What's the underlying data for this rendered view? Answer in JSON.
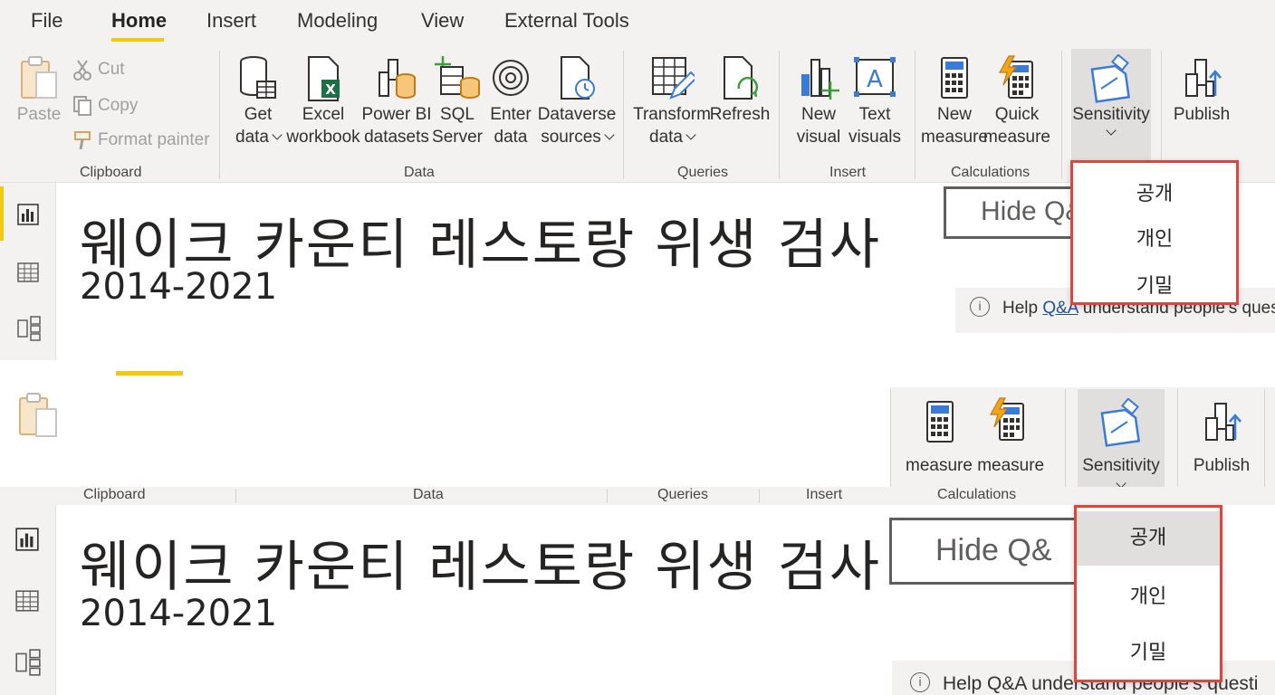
{
  "tabs": [
    "File",
    "Home",
    "Insert",
    "Modeling",
    "View",
    "External Tools"
  ],
  "clipboard": {
    "paste": "Paste",
    "cut": "Cut",
    "copy": "Copy",
    "format_painter": "Format painter",
    "group": "Clipboard"
  },
  "data_group": {
    "get_data": [
      "Get",
      "data"
    ],
    "excel": [
      "Excel",
      "workbook"
    ],
    "powerbi": [
      "Power BI",
      "datasets"
    ],
    "sql": [
      "SQL",
      "Server"
    ],
    "enter": [
      "Enter",
      "data"
    ],
    "dataverse": [
      "Dataverse",
      "sources"
    ],
    "group": "Data"
  },
  "queries": {
    "transform": [
      "Transform",
      "data"
    ],
    "refresh": "Refresh",
    "group": "Queries"
  },
  "insert": {
    "new_visual": [
      "New",
      "visual"
    ],
    "text_visuals": [
      "Text",
      "visuals"
    ],
    "group": "Insert"
  },
  "calculations": {
    "new_measure": [
      "New",
      "measure"
    ],
    "quick_measure": [
      "Quick",
      "measure"
    ],
    "group": "Calculations",
    "measure_row": "measure measure"
  },
  "sensitivity": {
    "label": "Sensitivity",
    "options": [
      "공개",
      "개인",
      "기밀"
    ]
  },
  "share": {
    "publish": "Publish"
  },
  "report": {
    "title": "웨이크 카운티 레스토랑 위생 검사",
    "subtitle": "2014-2021",
    "hide_qa": "Hide Q&",
    "help_prefix": "Help ",
    "help_link": "Q&A",
    "help_suffix": " understand people's questi",
    "help_suffix_2": " understand people's questi"
  },
  "colors": {
    "accent": "#f2c811",
    "highlight_border": "#e0453d",
    "ribbon_bg": "#f3f2f1"
  }
}
